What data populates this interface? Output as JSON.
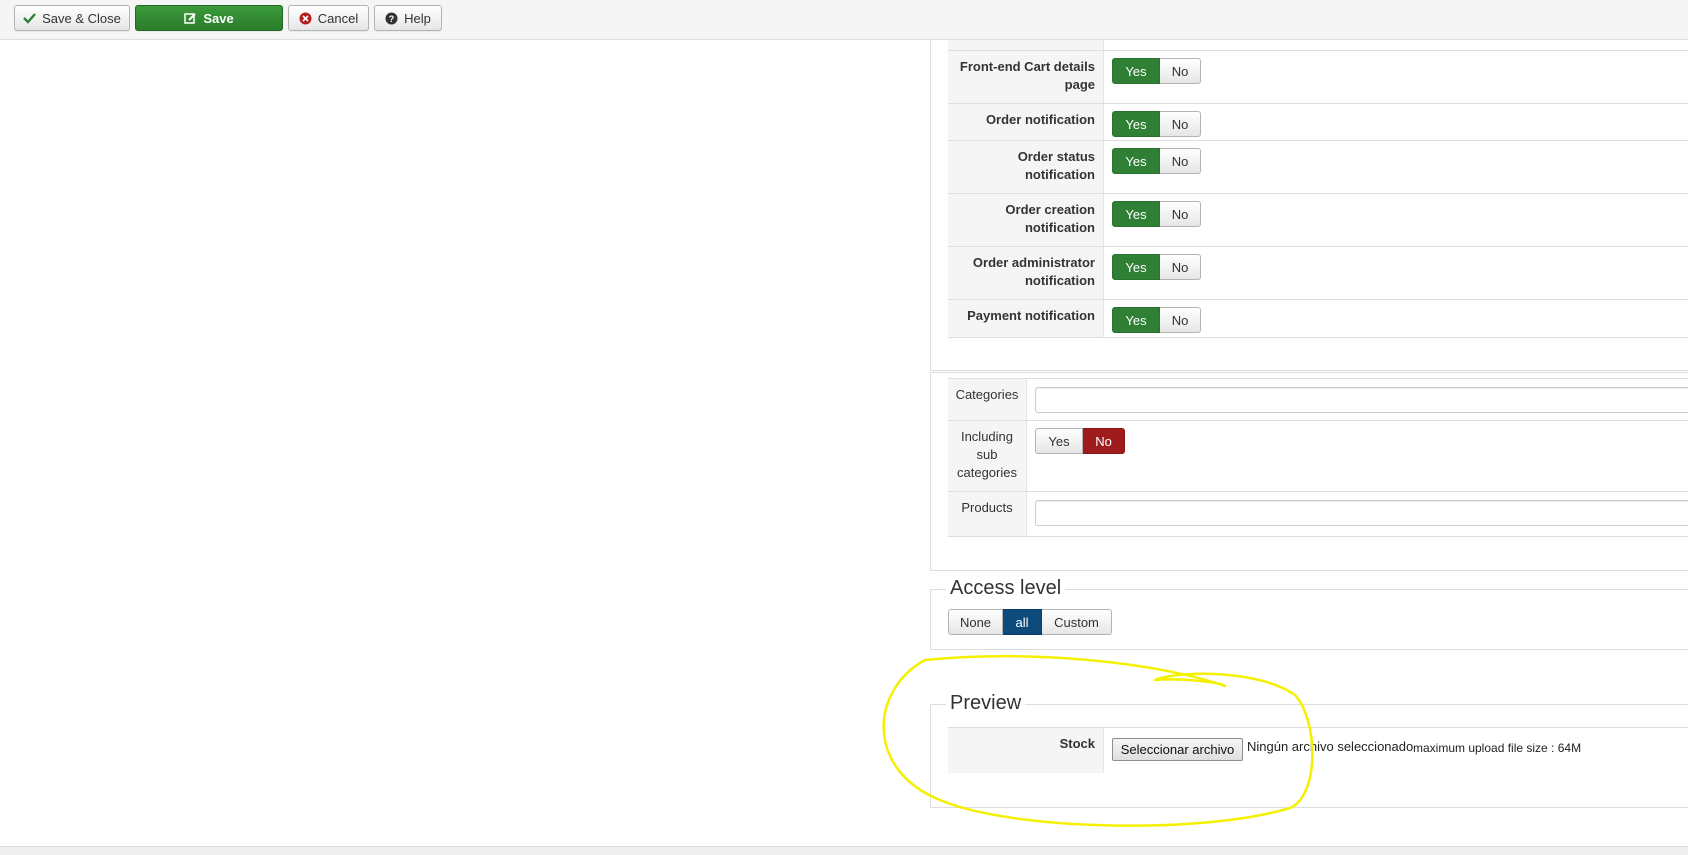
{
  "toolbar": {
    "save_close": "Save & Close",
    "save": "Save",
    "cancel": "Cancel",
    "help": "Help"
  },
  "notifications": [
    {
      "label": "Front-end Cart details page",
      "yes": "Yes",
      "no": "No",
      "selected": "Yes"
    },
    {
      "label": "Order notification",
      "yes": "Yes",
      "no": "No",
      "selected": "Yes"
    },
    {
      "label": "Order status notification",
      "yes": "Yes",
      "no": "No",
      "selected": "Yes"
    },
    {
      "label": "Order creation notification",
      "yes": "Yes",
      "no": "No",
      "selected": "Yes"
    },
    {
      "label": "Order administrator notification",
      "yes": "Yes",
      "no": "No",
      "selected": "Yes"
    },
    {
      "label": "Payment notification",
      "yes": "Yes",
      "no": "No",
      "selected": "Yes"
    }
  ],
  "restrictions": {
    "categories_label": "Categories",
    "categories_value": "",
    "subcat_label": "Including sub categories",
    "subcat_yes": "Yes",
    "subcat_no": "No",
    "subcat_selected": "No",
    "products_label": "Products",
    "products_value": ""
  },
  "access": {
    "legend": "Access level",
    "none": "None",
    "all": "all",
    "custom": "Custom",
    "selected": "all"
  },
  "preview": {
    "legend": "Preview",
    "stock_label": "Stock",
    "file_button": "Seleccionar archivo",
    "file_status": "Ningún archivo seleccionado",
    "max_upload": "maximum upload file size : 64M"
  },
  "colors": {
    "yes_active": "#2f7f35",
    "no_active": "#9e1c1c",
    "all_active": "#0f4a7c",
    "annotation": "#f5f000"
  },
  "icons": {
    "save_close": "check-icon",
    "save": "edit-icon",
    "cancel": "cancel-circle-icon",
    "help": "question-circle-icon"
  }
}
